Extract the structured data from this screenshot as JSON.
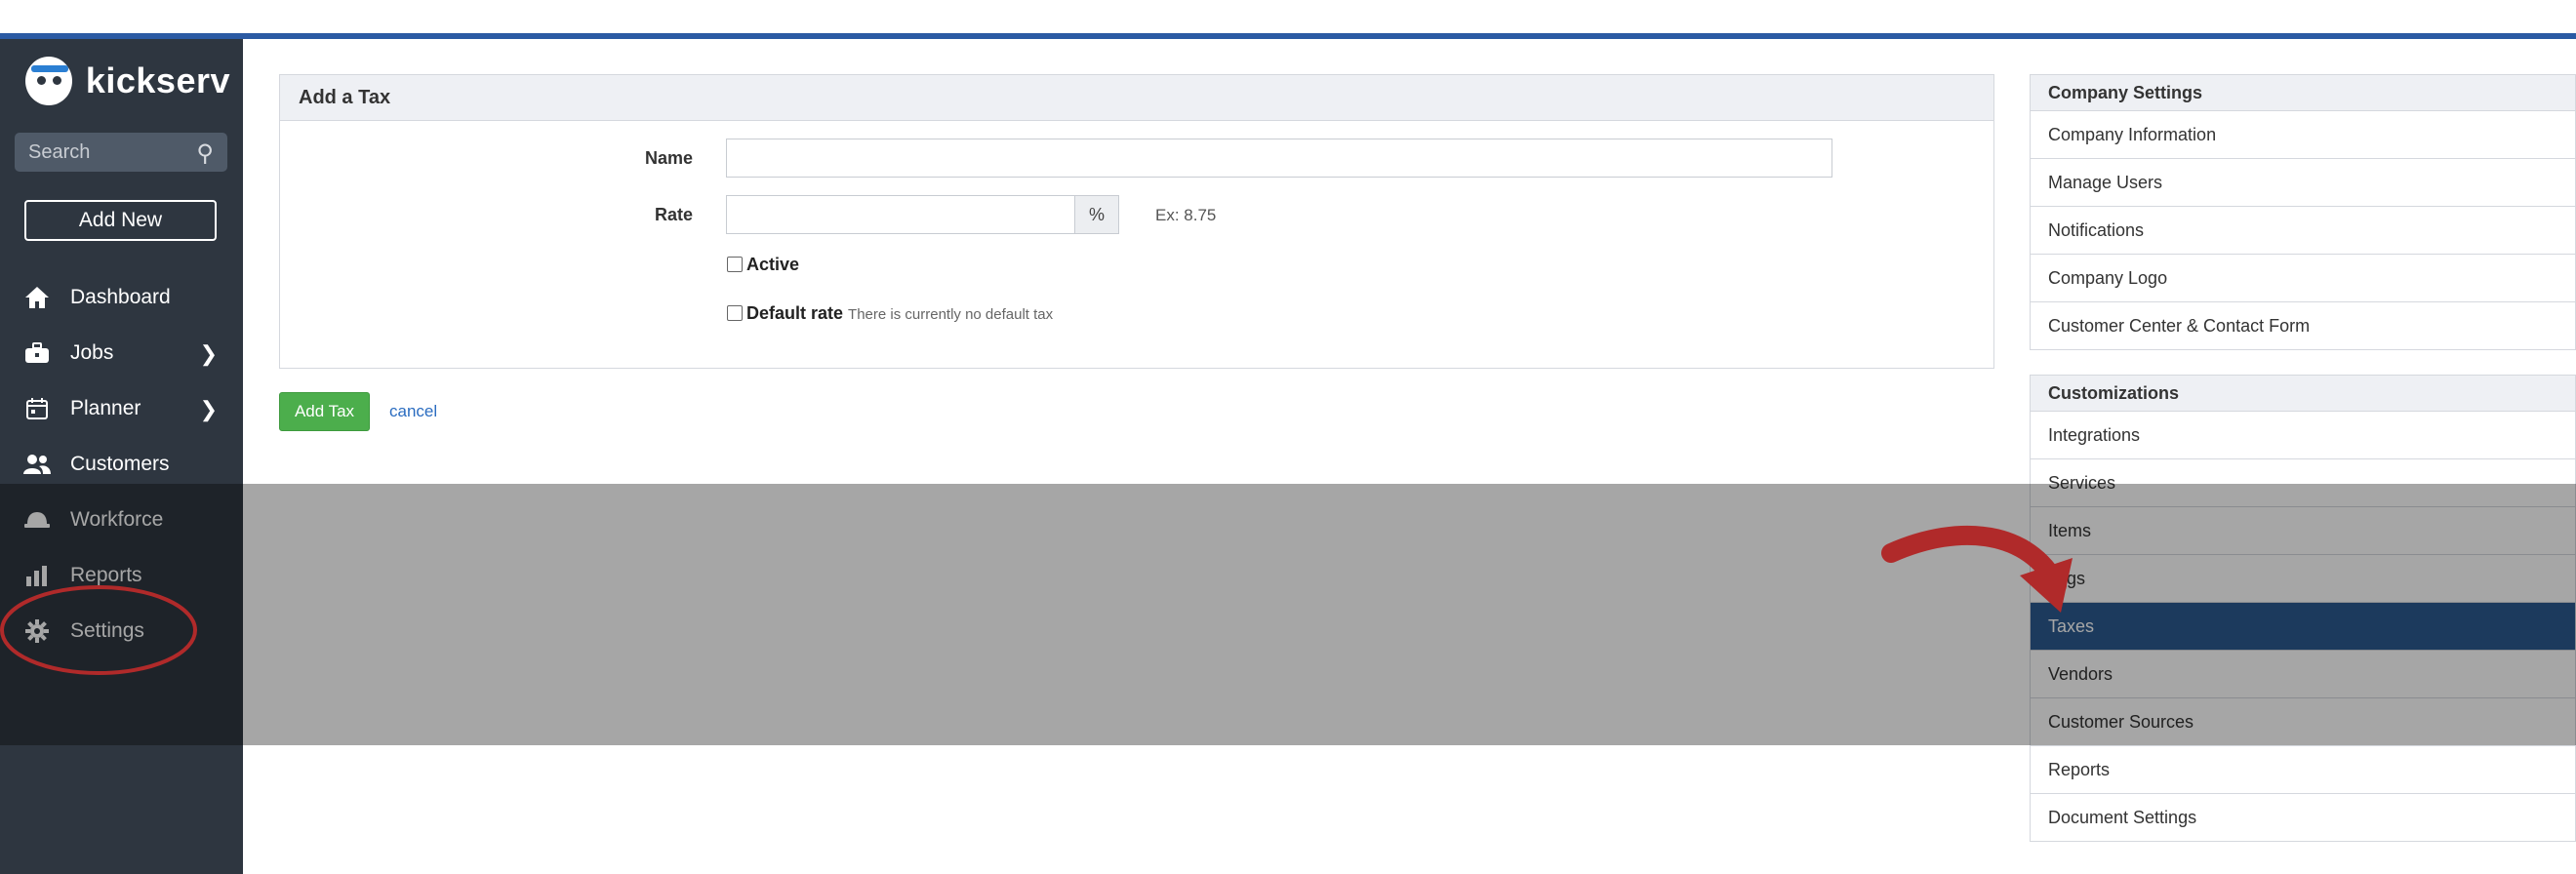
{
  "brand": {
    "name": "kickserv"
  },
  "sidebar": {
    "search": {
      "placeholder": "Search"
    },
    "add_new_label": "Add New",
    "items": [
      {
        "label": "Dashboard",
        "icon": "home-icon"
      },
      {
        "label": "Jobs",
        "icon": "briefcase-icon",
        "has_submenu": true
      },
      {
        "label": "Planner",
        "icon": "calendar-icon",
        "has_submenu": true
      },
      {
        "label": "Customers",
        "icon": "users-icon"
      },
      {
        "label": "Workforce",
        "icon": "hardhat-icon"
      },
      {
        "label": "Reports",
        "icon": "bar-chart-icon"
      },
      {
        "label": "Settings",
        "icon": "gear-icon"
      }
    ]
  },
  "form": {
    "title": "Add a Tax",
    "name_label": "Name",
    "name_value": "",
    "rate_label": "Rate",
    "rate_value": "",
    "rate_suffix": "%",
    "rate_hint": "Ex: 8.75",
    "active_label": "Active",
    "active_checked": false,
    "default_label": "Default rate",
    "default_note": "There is currently no default tax",
    "default_checked": false,
    "submit_label": "Add Tax",
    "cancel_label": "cancel"
  },
  "settings_menu": {
    "company_heading": "Company Settings",
    "company_items": [
      "Company Information",
      "Manage Users",
      "Notifications",
      "Company Logo",
      "Customer Center & Contact Form"
    ],
    "custom_heading": "Customizations",
    "custom_items": [
      "Integrations",
      "Services",
      "Items",
      "Tags",
      "Taxes",
      "Vendors",
      "Customer Sources",
      "Reports",
      "Document Settings"
    ],
    "active_item": "Taxes"
  },
  "colors": {
    "sidebar_bg": "#2e3640",
    "accent_blue": "#2b5aa3",
    "active_menu": "#2b5a8f",
    "button_green": "#4cae4c",
    "annotation_red": "#b02a2a"
  }
}
